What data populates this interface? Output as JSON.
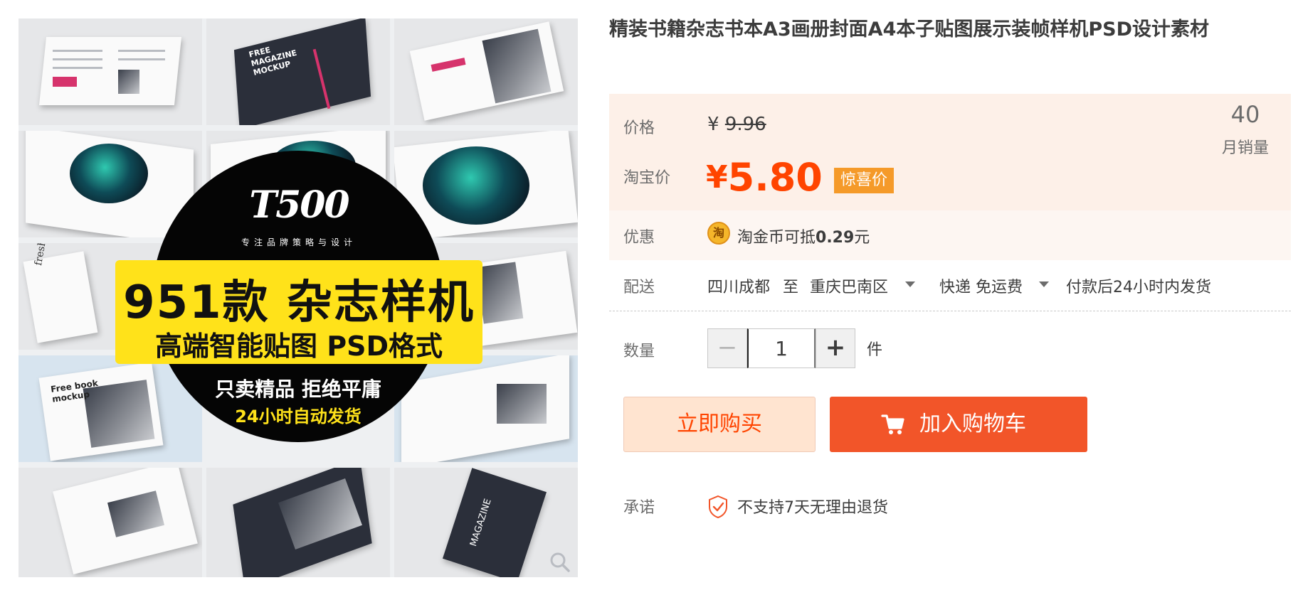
{
  "product": {
    "title": "精装书籍杂志书本A3画册封面A4本子贴图展示装帧样机PSD设计素材"
  },
  "banner": {
    "logo": "T500",
    "tagline": "专注品牌策略与设计",
    "headline": "951款 杂志样机",
    "subheadline": "高端智能贴图 PSD格式",
    "slogan": "只卖精品 拒绝平庸",
    "delivery_note": "24小时自动发货",
    "tile_texts": {
      "free_mockup": "FREE MAGAZINE MOCKUP",
      "fresh_free": "fresh&free",
      "free_book": "Free book mockup",
      "magazine": "MAGAZINE"
    }
  },
  "price": {
    "label": "价格",
    "currency": "¥",
    "original": "9.96",
    "taobao_label": "淘宝价",
    "taobao_currency": "¥",
    "taobao_price": "5.80",
    "tag": "惊喜价",
    "monthly_sales": "40",
    "monthly_sales_label": "月销量"
  },
  "promo": {
    "label": "优惠",
    "coin_glyph": "淘",
    "text_prefix": "淘金币可抵",
    "amount": "0.29",
    "text_suffix": "元"
  },
  "shipping": {
    "label": "配送",
    "from": "四川成都",
    "to_word": "至",
    "destination": "重庆巴南区",
    "method": "快递 免运费",
    "dispatch": "付款后24小时内发货"
  },
  "quantity": {
    "label": "数量",
    "minus": "−",
    "value": "1",
    "plus": "+",
    "unit": "件"
  },
  "actions": {
    "buy_now": "立即购买",
    "add_to_cart": "加入购物车"
  },
  "promise": {
    "label": "承诺",
    "text": "不支持7天无理由退货"
  },
  "colors": {
    "accent": "#ff4400",
    "cart_button": "#f25529",
    "buy_now_bg": "#ffe4d0",
    "tag_bg": "#f59a29",
    "price_box_bg": "#fdf0e8"
  },
  "icons": [
    "zoom-icon",
    "coin-icon",
    "caret-down-icon",
    "cart-icon",
    "shield-check-icon"
  ]
}
